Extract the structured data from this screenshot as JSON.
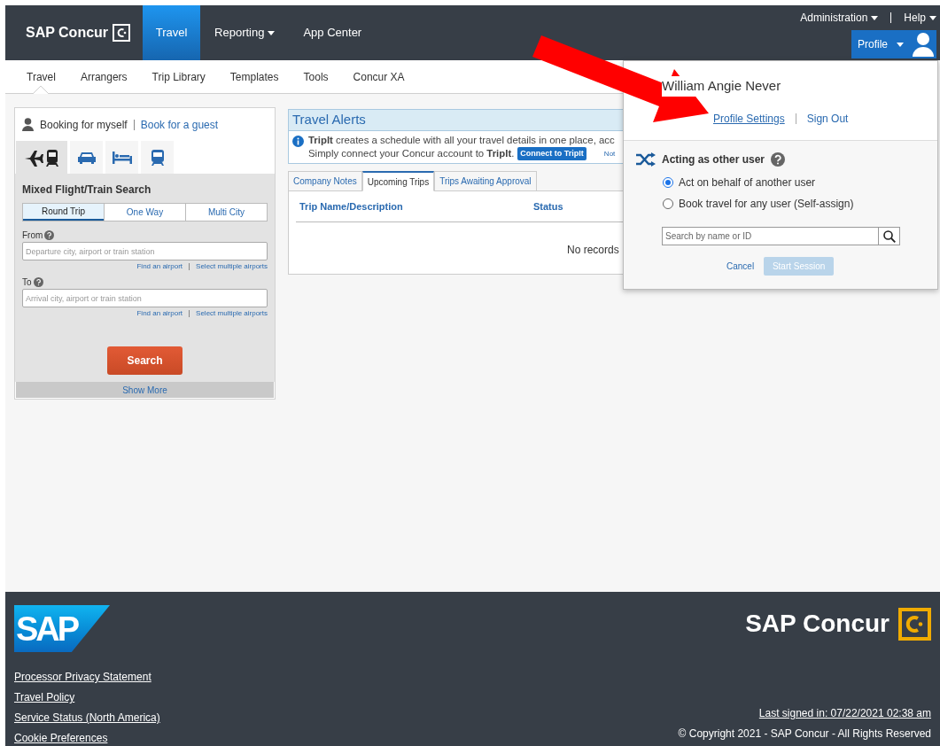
{
  "header": {
    "logo": "SAP Concur",
    "nav": [
      {
        "label": "Travel",
        "selected": true,
        "dropdown": false
      },
      {
        "label": "Reporting",
        "selected": false,
        "dropdown": true
      },
      {
        "label": "App Center",
        "selected": false,
        "dropdown": false
      }
    ],
    "utility": [
      "Administration",
      "Help"
    ],
    "profile_button": "Profile"
  },
  "subnav": [
    {
      "label": "Travel",
      "selected": true
    },
    {
      "label": "Arrangers",
      "selected": false
    },
    {
      "label": "Trip Library",
      "selected": false
    },
    {
      "label": "Templates",
      "selected": false
    },
    {
      "label": "Tools",
      "selected": false
    },
    {
      "label": "Concur XA",
      "selected": false
    }
  ],
  "booking": {
    "for_self": "Booking for myself",
    "for_guest": "Book for a guest",
    "modes": [
      {
        "kind": "flight-train",
        "selected": true
      },
      {
        "kind": "car",
        "selected": false
      },
      {
        "kind": "hotel",
        "selected": false
      },
      {
        "kind": "train",
        "selected": false
      }
    ],
    "title": "Mixed Flight/Train Search",
    "trip_types": [
      {
        "label": "Round Trip",
        "selected": true
      },
      {
        "label": "One Way",
        "selected": false
      },
      {
        "label": "Multi City",
        "selected": false
      }
    ],
    "fields": [
      {
        "label": "From",
        "placeholder": "Departure city, airport or train station",
        "links": [
          "Find an airport",
          "Select multiple airports"
        ]
      },
      {
        "label": "To",
        "placeholder": "Arrival city, airport or train station",
        "links": [
          "Find an airport",
          "Select multiple airports"
        ]
      }
    ],
    "search_button": "Search",
    "show_more": "Show More"
  },
  "alerts": {
    "title": "Travel Alerts",
    "line_1": "**TripIt** creates a schedule with all your travel details in one place, acc",
    "line_2": "Simply connect your Concur account to **TripIt**.",
    "connect_button": "Connect to TripIt",
    "dismiss": "Not"
  },
  "trips": {
    "tabs": [
      {
        "label": "Company Notes",
        "selected": false
      },
      {
        "label": "Upcoming Trips",
        "selected": true
      },
      {
        "label": "Trips Awaiting Approval",
        "selected": false
      }
    ],
    "columns": [
      "Trip Name/Description",
      "Status"
    ],
    "empty": "No records"
  },
  "profile_menu": {
    "name": "William Angie Never",
    "links": [
      "Profile Settings",
      "Sign Out"
    ],
    "acting": {
      "title": "Acting as other user",
      "options": [
        {
          "label": "Act on behalf of another user",
          "selected": true
        },
        {
          "label": "Book travel for any user (Self-assign)",
          "selected": false
        }
      ],
      "search_placeholder": "Search by name or ID",
      "cancel": "Cancel",
      "start": "Start Session",
      "start_disabled": true
    }
  },
  "footer": {
    "sap_logo": "SAP",
    "brand": "SAP Concur",
    "links": [
      "Processor Privacy Statement",
      "Travel Policy",
      "Service Status (North America)",
      "Cookie Preferences"
    ],
    "last_signed": "Last signed in: 07/22/2021 02:38 am",
    "copyright": "© Copyright 2021 - SAP Concur - All Rights Reserved"
  }
}
